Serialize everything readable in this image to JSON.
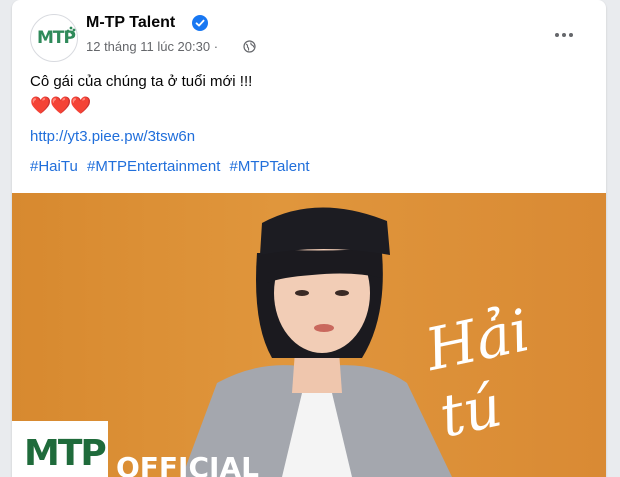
{
  "post": {
    "page_name": "M-TP Talent",
    "timestamp": "12 tháng 11 lúc 20:30 ·",
    "text": "Cô gái của chúng ta ở tuổi mới !!!",
    "hearts": "❤️❤️❤️",
    "link": "http://yt3.piee.pw/3tsw6n",
    "hashtags": [
      "#HaiTu",
      "#MTPEntertainment",
      "#MTPTalent"
    ]
  },
  "avatar": {
    "text": "MTP"
  },
  "media": {
    "signature": "Hải tú",
    "logo": "MTP",
    "badge": "OFFICIAL"
  },
  "colors": {
    "link": "#216fdb",
    "verified": "#1877f2",
    "media_bg": "#dd8f37"
  },
  "icons": [
    "verified-icon",
    "globe-icon",
    "more-icon"
  ]
}
